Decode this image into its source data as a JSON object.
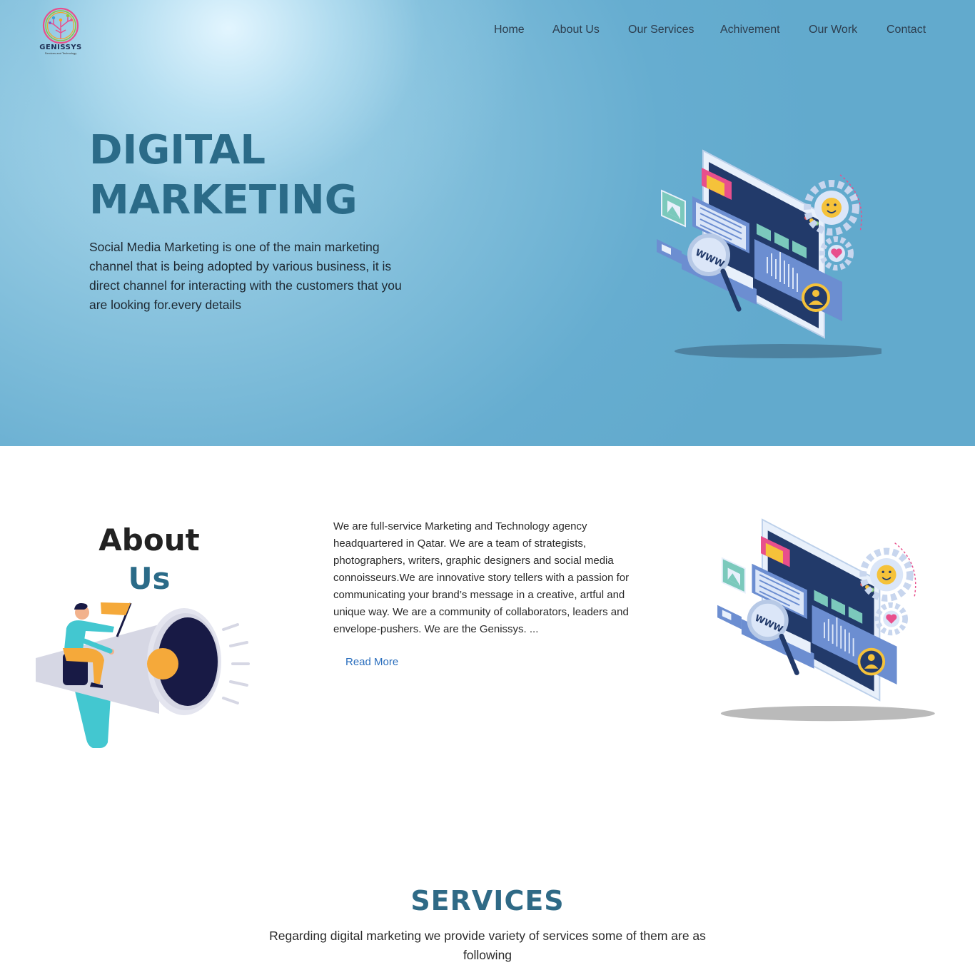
{
  "brand": {
    "name": "GENISSYS",
    "tagline": "Services and Technology"
  },
  "nav": {
    "items": [
      {
        "label": "Home"
      },
      {
        "label": "About Us"
      },
      {
        "label": "Our Services"
      },
      {
        "label": "Achivement"
      },
      {
        "label": "Our Work"
      },
      {
        "label": "Contact"
      }
    ]
  },
  "hero": {
    "title_line1": "DIGITAL",
    "title_line2": "MARKETING",
    "description": "Social Media Marketing is one of the main marketing channel that is being adopted by various business, it is direct channel for interacting with the customers that you are looking for.every details",
    "illustration_label": "WWW"
  },
  "about": {
    "title_line1": "About",
    "title_line2": "Us",
    "text": "We are full-service Marketing and Technology agency headquartered in Qatar. We are a team of strategists, photographers, writers, graphic designers and social media connoisseurs.We are innovative story tellers with a passion for communicating your brand’s message in a creative, artful and unique way. We are a community of collaborators, leaders and envelope-pushers. We are the Genissys. ...",
    "read_more": "Read More",
    "illustration_label": "WWW"
  },
  "services": {
    "title": "SERVICES",
    "description": "Regarding digital marketing we provide variety of services some of them are as following"
  },
  "colors": {
    "heading_accent": "#2b6b88",
    "link": "#2a6ebd",
    "hero_bg": "#62aacd"
  }
}
